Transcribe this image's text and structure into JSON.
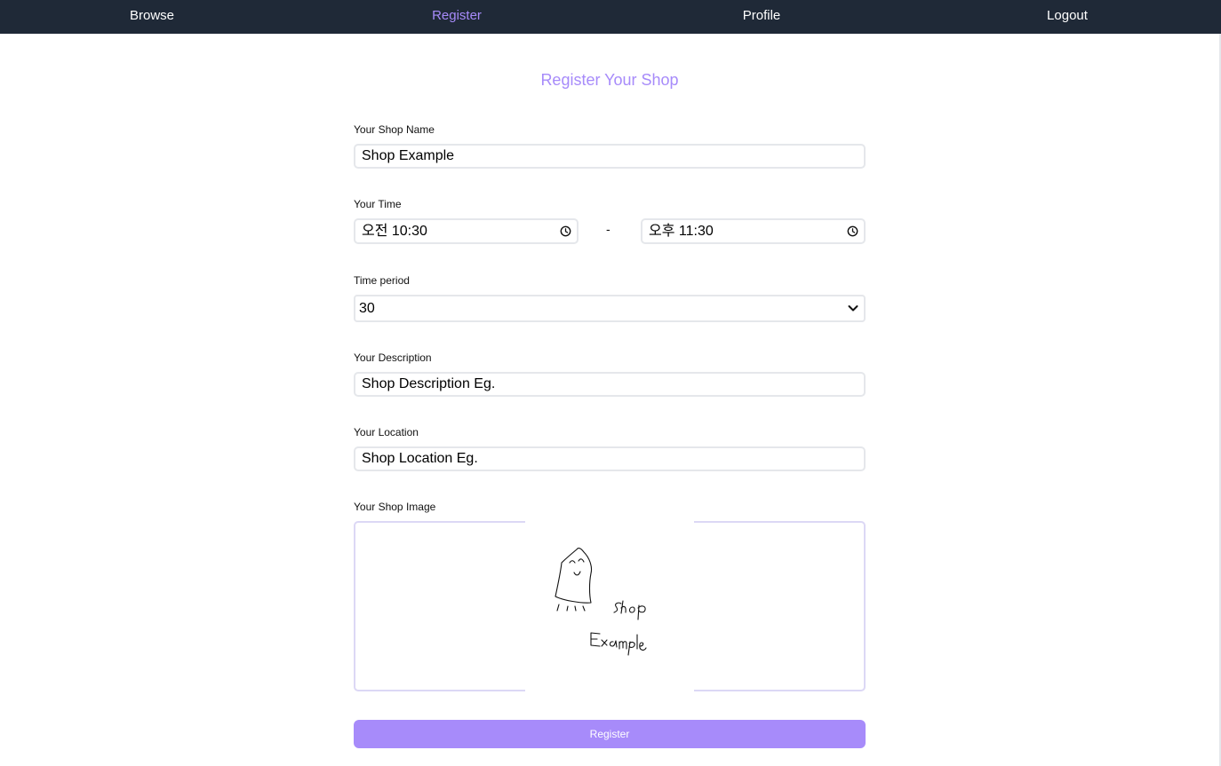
{
  "nav": {
    "items": [
      {
        "label": "Browse",
        "active": false
      },
      {
        "label": "Register",
        "active": true
      },
      {
        "label": "Profile",
        "active": false
      },
      {
        "label": "Logout",
        "active": false
      }
    ]
  },
  "colors": {
    "navbar_bg": "#1f2937",
    "accent": "#a78bfa",
    "input_border": "#e5e7eb"
  },
  "form": {
    "title": "Register Your Shop",
    "shop_name": {
      "label": "Your Shop Name",
      "value": "Shop Example"
    },
    "time": {
      "label": "Your Time",
      "start": "오전 10:30",
      "separator": "-",
      "end": "오후 11:30",
      "icon": "clock-icon"
    },
    "period": {
      "label": "Time period",
      "selected": "30",
      "icon": "chevron-down-icon"
    },
    "description": {
      "label": "Your Description",
      "value": "Shop Description Eg."
    },
    "location": {
      "label": "Your Location",
      "value": "Shop Location Eg."
    },
    "image": {
      "label": "Your Shop Image",
      "handwritten_text": "Shop Example"
    },
    "submit_label": "Register"
  }
}
